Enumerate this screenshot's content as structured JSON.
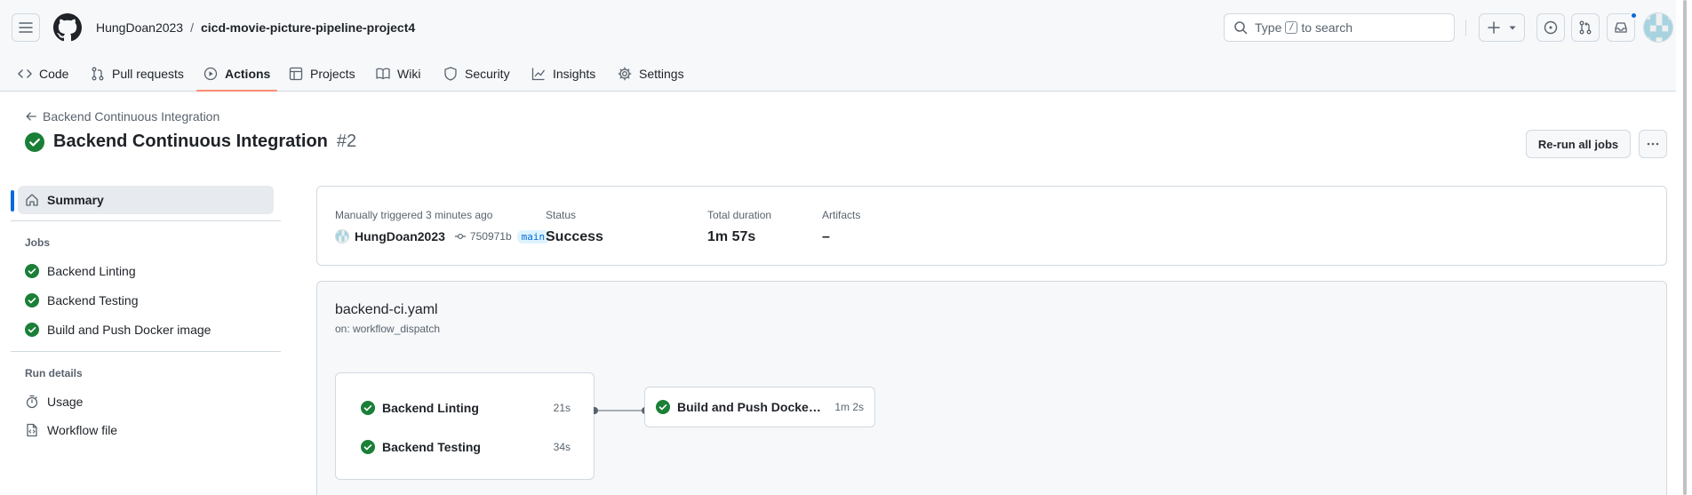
{
  "header": {
    "repo_owner": "HungDoan2023",
    "repo_separator": "/",
    "repo_name": "cicd-movie-picture-pipeline-project4",
    "search": {
      "prefix": "Type",
      "key": "/",
      "suffix": "to search"
    }
  },
  "repo_nav": [
    {
      "label": "Code",
      "icon": "code-icon"
    },
    {
      "label": "Pull requests",
      "icon": "git-pull-request-icon"
    },
    {
      "label": "Actions",
      "icon": "play-icon",
      "active": true
    },
    {
      "label": "Projects",
      "icon": "table-icon"
    },
    {
      "label": "Wiki",
      "icon": "book-icon"
    },
    {
      "label": "Security",
      "icon": "shield-icon"
    },
    {
      "label": "Insights",
      "icon": "graph-icon"
    },
    {
      "label": "Settings",
      "icon": "gear-icon"
    }
  ],
  "run": {
    "back_label": "Backend Continuous Integration",
    "title": "Backend Continuous Integration",
    "number": "#2",
    "status_icon": "check-circle-fill-icon",
    "rerun_label": "Re-run all jobs"
  },
  "sidebar": {
    "summary_label": "Summary",
    "jobs_heading": "Jobs",
    "jobs": [
      {
        "label": "Backend Linting"
      },
      {
        "label": "Backend Testing"
      },
      {
        "label": "Build and Push Docker image"
      }
    ],
    "run_details_heading": "Run details",
    "run_details": [
      {
        "label": "Usage",
        "icon": "stopwatch-icon"
      },
      {
        "label": "Workflow file",
        "icon": "file-code-icon"
      }
    ]
  },
  "summary": {
    "trigger_label": "Manually triggered 3 minutes ago",
    "actor": "HungDoan2023",
    "commit_sha": "750971b",
    "branch": "main",
    "status_label": "Status",
    "status_value": "Success",
    "duration_label": "Total duration",
    "duration_value": "1m 57s",
    "artifacts_label": "Artifacts",
    "artifacts_value": "–"
  },
  "workflow": {
    "file": "backend-ci.yaml",
    "trigger": "on: workflow_dispatch",
    "group_jobs": [
      {
        "name": "Backend Linting",
        "duration": "21s"
      },
      {
        "name": "Backend Testing",
        "duration": "34s"
      }
    ],
    "next_job": {
      "name": "Build and Push Docker i...",
      "duration": "1m 2s"
    }
  },
  "colors": {
    "success": "#1a7f37",
    "accent": "#0969da",
    "nav_underline": "#fd8c73"
  }
}
